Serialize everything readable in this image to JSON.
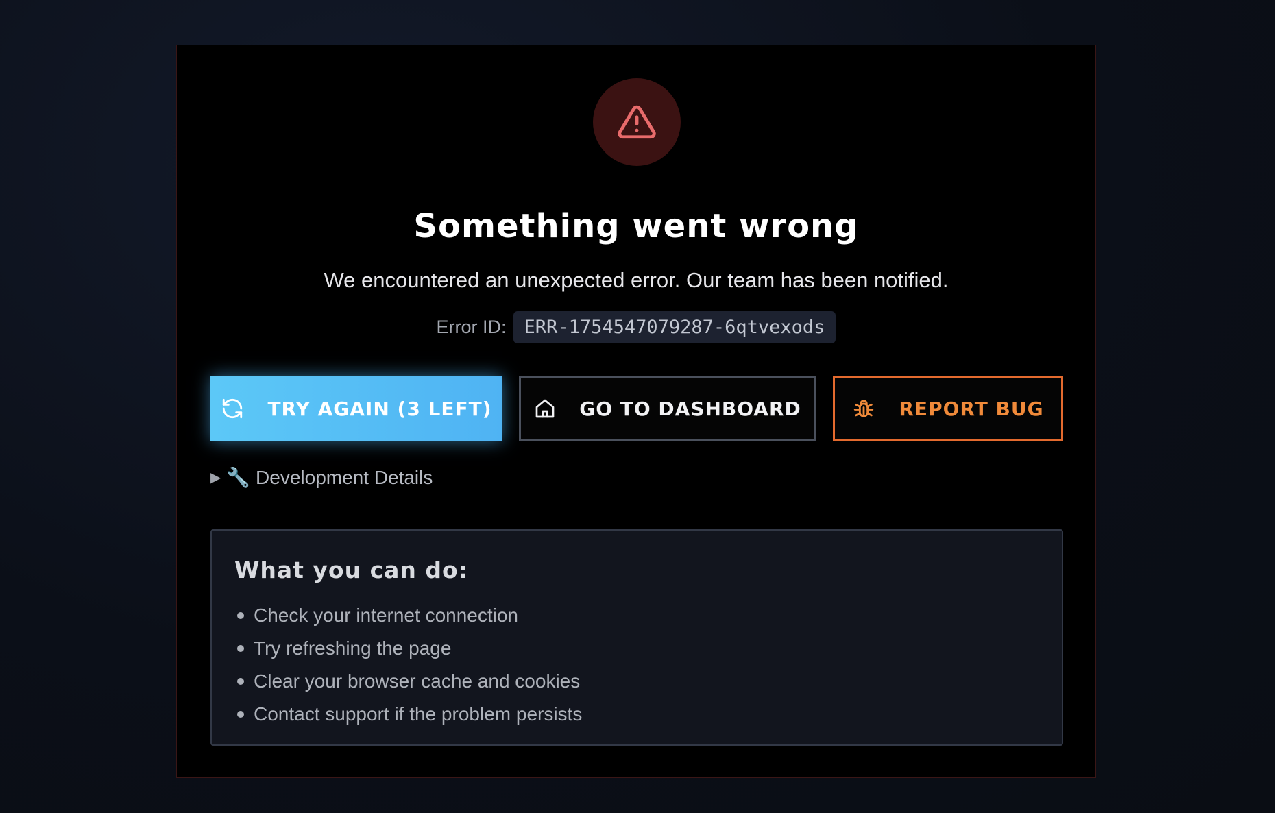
{
  "error": {
    "title": "Something went wrong",
    "message": "We encountered an unexpected error. Our team has been notified.",
    "id_label": "Error ID:",
    "id_value": "ERR-1754547079287-6qtvexods"
  },
  "actions": {
    "retry_label": "TRY AGAIN (3 LEFT)",
    "dashboard_label": "GO TO DASHBOARD",
    "report_label": "REPORT BUG"
  },
  "dev_details": {
    "label": "🔧 Development Details"
  },
  "help": {
    "title": "What you can do:",
    "items": [
      "Check your internet connection",
      "Try refreshing the page",
      "Clear your browser cache and cookies",
      "Contact support if the problem persists"
    ]
  },
  "colors": {
    "accent_primary": "#4fb3f3",
    "danger": "#e86b6b",
    "report_accent": "#e36a2e"
  },
  "icons": {
    "header": "warning-triangle-icon",
    "retry": "refresh-icon",
    "dashboard": "home-icon",
    "report": "bug-icon",
    "disclosure": "triangle-right-icon",
    "dev": "wrench-icon"
  }
}
